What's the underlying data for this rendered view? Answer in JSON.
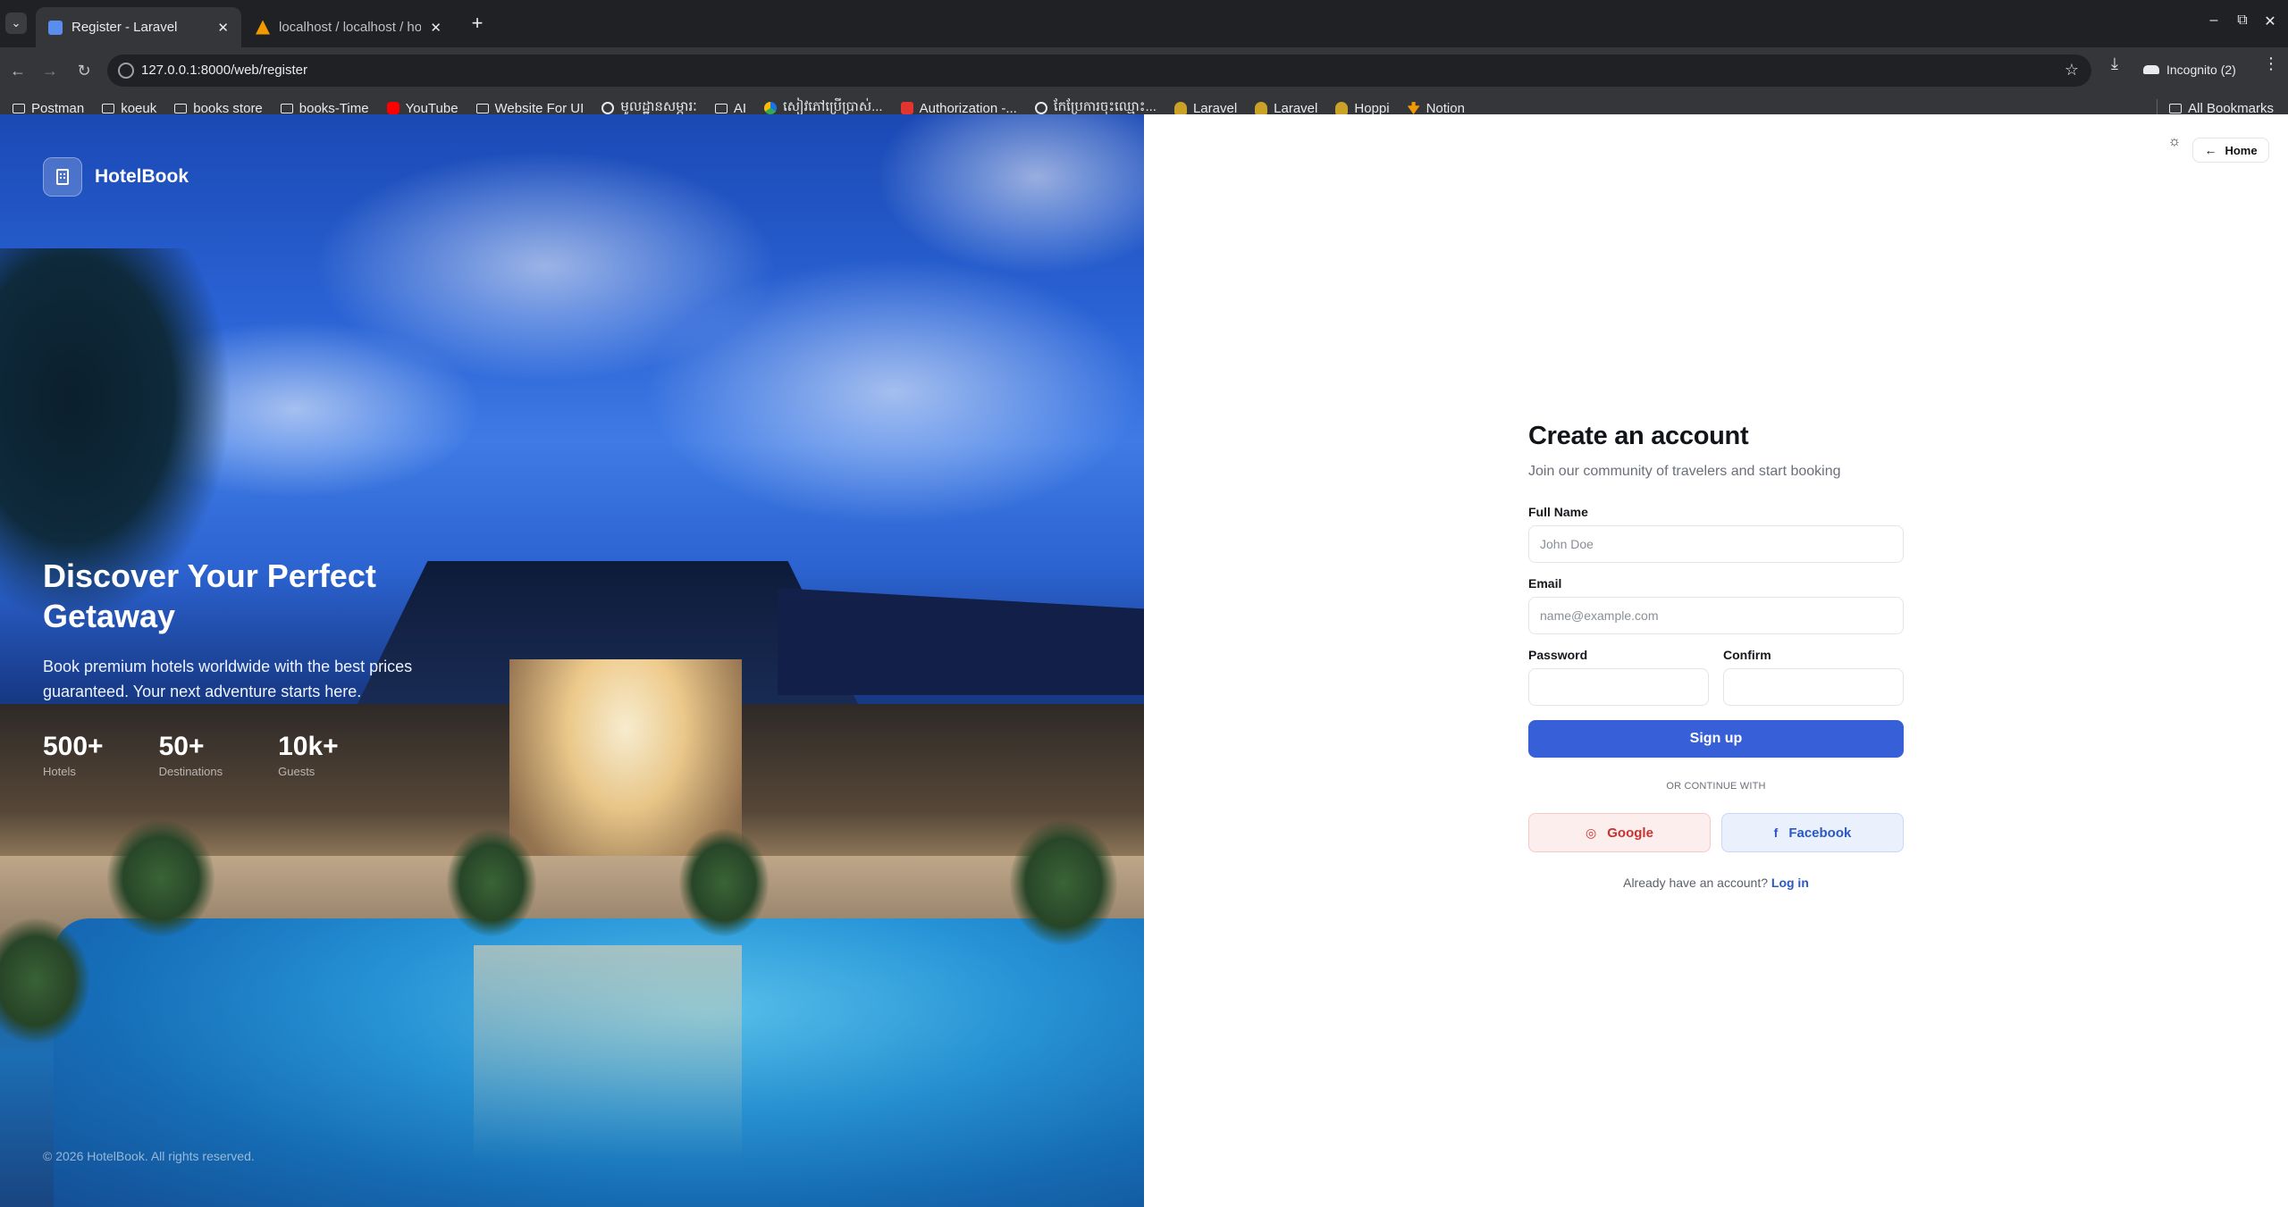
{
  "browser": {
    "tabs": [
      {
        "title": "Register - Laravel",
        "active": true,
        "favicon_color": "#5b8def"
      },
      {
        "title": "localhost / localhost / ho",
        "active": false,
        "favicon_color": "#f29900"
      }
    ],
    "url": "127.0.0.1:8000/web/register",
    "incognito_label": "Incognito (2)",
    "bookmarks": [
      {
        "label": "Postman",
        "icon": "folder-icon"
      },
      {
        "label": "koeuk",
        "icon": "folder-icon"
      },
      {
        "label": "books store",
        "icon": "folder-icon"
      },
      {
        "label": "books-Time",
        "icon": "folder-icon"
      },
      {
        "label": "YouTube",
        "icon": "youtube-icon"
      },
      {
        "label": "Website For UI",
        "icon": "folder-icon"
      },
      {
        "label": "មូលដ្ឋានសម្ភារៈ",
        "icon": "globe-icon"
      },
      {
        "label": "AI",
        "icon": "folder-icon"
      },
      {
        "label": "សៀវភៅប្រើប្រាស់...",
        "icon": "drive-icon"
      },
      {
        "label": "Authorization -...",
        "icon": "laravel-icon"
      },
      {
        "label": "កែប្រែការចុះឈ្មោះ...",
        "icon": "globe-icon"
      },
      {
        "label": "Laravel",
        "icon": "hat-icon"
      },
      {
        "label": "Laravel",
        "icon": "hat-icon"
      },
      {
        "label": "Hoppi",
        "icon": "hat-icon"
      },
      {
        "label": "Notion",
        "icon": "notion-icon"
      }
    ],
    "all_bookmarks": "All Bookmarks"
  },
  "hero": {
    "brand": "HotelBook",
    "title": "Discover Your Perfect Getaway",
    "subtitle": "Book premium hotels worldwide with the best prices guaranteed. Your next adventure starts here.",
    "stats": [
      {
        "value": "500+",
        "label": "Hotels"
      },
      {
        "value": "50+",
        "label": "Destinations"
      },
      {
        "value": "10k+",
        "label": "Guests"
      }
    ],
    "copyright": "© 2026 HotelBook. All rights reserved."
  },
  "header": {
    "home_label": "Home"
  },
  "form": {
    "title": "Create an account",
    "subtitle": "Join our community of travelers and start booking",
    "full_name_label": "Full Name",
    "full_name_placeholder": "John Doe",
    "email_label": "Email",
    "email_placeholder": "name@example.com",
    "password_label": "Password",
    "confirm_label": "Confirm",
    "submit_label": "Sign up",
    "divider": "OR CONTINUE WITH",
    "google_label": "Google",
    "facebook_label": "Facebook",
    "login_prompt": "Already have an account?",
    "login_link": "Log in"
  },
  "colors": {
    "primary": "#3760d8",
    "google": "#c8322f",
    "facebook": "#2a58c4"
  }
}
